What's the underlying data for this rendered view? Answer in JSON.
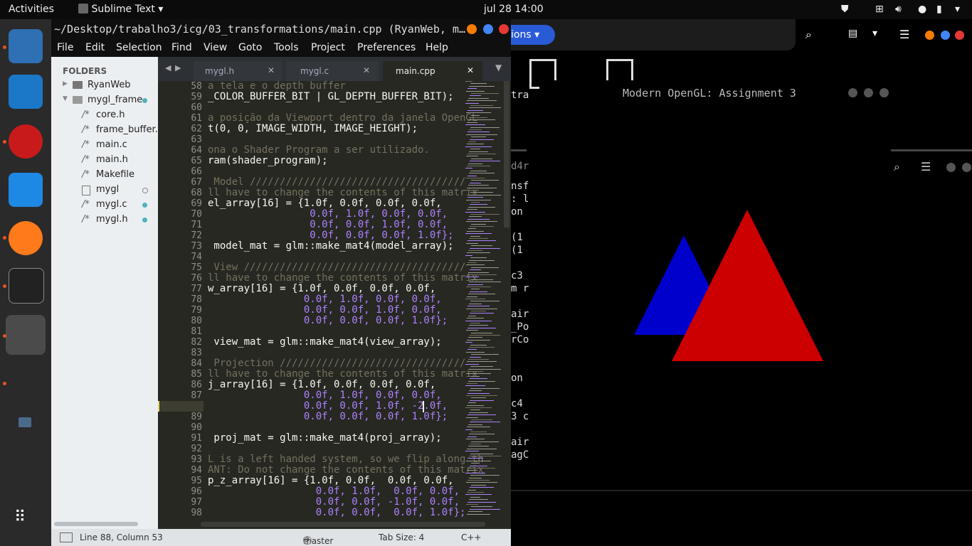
{
  "topbar": {
    "activities": "Activities",
    "app": "Sublime Text",
    "clock": "jul 28  14:00"
  },
  "sublime": {
    "title": "~/Desktop/trabalho3/icg/03_transformations/main.cpp (RyanWeb, m…",
    "menu": [
      "File",
      "Edit",
      "Selection",
      "Find",
      "View",
      "Goto",
      "Tools",
      "Project",
      "Preferences",
      "Help"
    ],
    "folders_label": "FOLDERS",
    "tree": [
      {
        "label": "RyanWeb",
        "type": "folder"
      },
      {
        "label": "mygl_frame",
        "type": "folder-open"
      },
      {
        "label": "core.h",
        "prefix": "/*"
      },
      {
        "label": "frame_buffer.h",
        "prefix": "/*"
      },
      {
        "label": "main.c",
        "prefix": "/*"
      },
      {
        "label": "main.h",
        "prefix": "/*"
      },
      {
        "label": "Makefile",
        "prefix": "/*"
      },
      {
        "label": "mygl",
        "prefix": "file"
      },
      {
        "label": "mygl.c",
        "prefix": "/*"
      },
      {
        "label": "mygl.h",
        "prefix": "/*"
      }
    ],
    "tabs": [
      "mygl.h",
      "mygl.c",
      "main.cpp"
    ],
    "status": {
      "position": "Line 88, Column 53",
      "branch": "master",
      "changes": "3",
      "tabsize": "Tab Size: 4",
      "syntax": "C++"
    }
  },
  "code_lines": [
    {
      "n": "58",
      "t": "a tela e o depth buffer",
      "c": "cm"
    },
    {
      "n": "59",
      "t": "_COLOR_BUFFER_BIT | GL_DEPTH_BUFFER_BIT);",
      "c": ""
    },
    {
      "n": "60",
      "t": "",
      "c": ""
    },
    {
      "n": "61",
      "t": "a posição da Viewport dentro da janela OpenGL",
      "c": "cm"
    },
    {
      "n": "62",
      "t": "t(0, 0, IMAGE_WIDTH, IMAGE_HEIGHT);",
      "c": ""
    },
    {
      "n": "63",
      "t": "",
      "c": ""
    },
    {
      "n": "64",
      "t": "ona o Shader Program a ser utilizado.",
      "c": "cm"
    },
    {
      "n": "65",
      "t": "ram(shader_program);",
      "c": ""
    },
    {
      "n": "66",
      "t": "",
      "c": ""
    },
    {
      "n": "67",
      "t": " Model ////////////////////////////////////",
      "c": "cm"
    },
    {
      "n": "68",
      "t": "ll have to change the contents of this matrix",
      "c": "cm"
    },
    {
      "n": "69",
      "t": "el_array[16] = {1.0f, 0.0f, 0.0f, 0.0f,",
      "c": ""
    },
    {
      "n": "70",
      "t": "                 0.0f, 1.0f, 0.0f, 0.0f,",
      "c": "num"
    },
    {
      "n": "71",
      "t": "                 0.0f, 0.0f, 1.0f, 0.0f,",
      "c": "num"
    },
    {
      "n": "72",
      "t": "                 0.0f, 0.0f, 0.0f, 1.0f};",
      "c": "num"
    },
    {
      "n": "73",
      "t": " model_mat = glm::make_mat4(model_array);",
      "c": ""
    },
    {
      "n": "74",
      "t": "",
      "c": ""
    },
    {
      "n": "75",
      "t": " View /////////////////////////////////////",
      "c": "cm"
    },
    {
      "n": "76",
      "t": "ll have to change the contents of this matrix",
      "c": "cm"
    },
    {
      "n": "77",
      "t": "w_array[16] = {1.0f, 0.0f, 0.0f, 0.0f,",
      "c": ""
    },
    {
      "n": "78",
      "t": "                0.0f, 1.0f, 0.0f, 0.0f,",
      "c": "num"
    },
    {
      "n": "79",
      "t": "                0.0f, 0.0f, 1.0f, 0.0f,",
      "c": "num"
    },
    {
      "n": "80",
      "t": "                0.0f, 0.0f, 0.0f, 1.0f};",
      "c": "num"
    },
    {
      "n": "81",
      "t": "",
      "c": ""
    },
    {
      "n": "82",
      "t": " view_mat = glm::make_mat4(view_array);",
      "c": ""
    },
    {
      "n": "83",
      "t": "",
      "c": ""
    },
    {
      "n": "84",
      "t": " Projection ///////////////////////////////",
      "c": "cm"
    },
    {
      "n": "85",
      "t": "ll have to change the contents of this matrix",
      "c": "cm"
    },
    {
      "n": "86",
      "t": "j_array[16] = {1.0f, 0.0f, 0.0f, 0.0f,",
      "c": ""
    },
    {
      "n": "87",
      "t": "                0.0f, 1.0f, 0.0f, 0.0f,",
      "c": "num"
    },
    {
      "n": "88",
      "t": "                0.0f, 0.0f, 1.0f, -2.0f,",
      "c": "num"
    },
    {
      "n": "89",
      "t": "                0.0f, 0.0f, 0.0f, 1.0f};",
      "c": "num"
    },
    {
      "n": "90",
      "t": "",
      "c": ""
    },
    {
      "n": "91",
      "t": " proj_mat = glm::make_mat4(proj_array);",
      "c": ""
    },
    {
      "n": "92",
      "t": "",
      "c": ""
    },
    {
      "n": "93",
      "t": "L is a left handed system, so we flip along th",
      "c": "cm"
    },
    {
      "n": "94",
      "t": "ANT: Do not change the contents of this matrix",
      "c": "cm"
    },
    {
      "n": "95",
      "t": "p_z_array[16] = {1.0f, 0.0f,  0.0f, 0.0f,",
      "c": ""
    },
    {
      "n": "96",
      "t": "                  0.0f, 1.0f,  0.0f, 0.0f,",
      "c": "num"
    },
    {
      "n": "97",
      "t": "                  0.0f, 0.0f, -1.0f, 0.0f,",
      "c": "num"
    },
    {
      "n": "98",
      "t": "                  0.0f, 0.0f,  0.0f, 1.0f};",
      "c": "num"
    }
  ],
  "gl_window": {
    "title": "Modern OpenGL: Assignment 3"
  },
  "bg_fragments": {
    "tab": "ions",
    "lines": [
      "tra",
      "d4r",
      "nsf",
      ": l",
      "on",
      "(1",
      "(1",
      "c3",
      "m r",
      "air",
      "_Po",
      "rCo",
      "on",
      "c4",
      "3 c",
      "air",
      "agC"
    ]
  },
  "colors": {
    "blue_triangle": "#0000cc",
    "red_triangle": "#cc0000"
  }
}
